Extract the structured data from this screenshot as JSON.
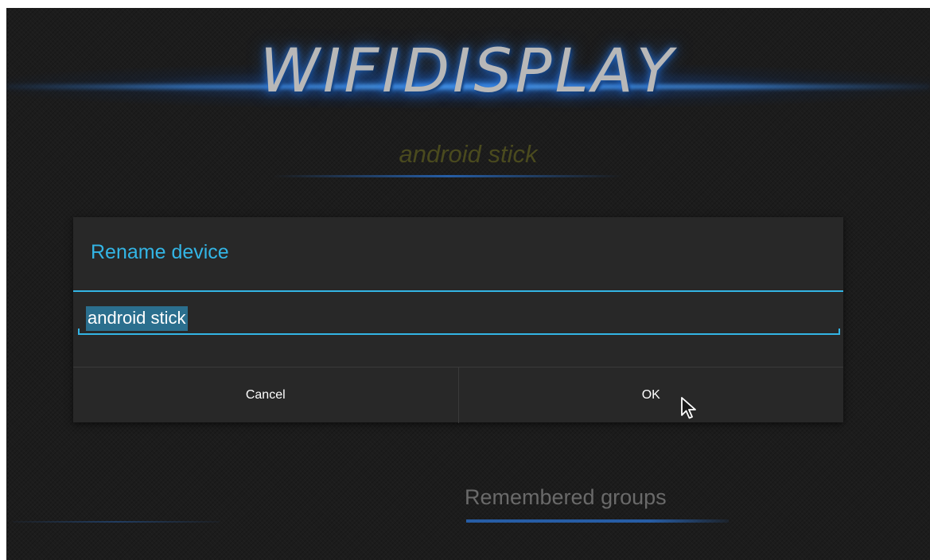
{
  "app": {
    "logo_text": "WIFIDISPLAY",
    "device_subtitle": "android stick"
  },
  "dialog": {
    "title": "Rename device",
    "input_value": "android stick",
    "cancel_label": "Cancel",
    "ok_label": "OK"
  },
  "background": {
    "section_label": "Remembered groups"
  },
  "icons": {
    "cursor": "mouse-pointer-icon"
  },
  "colors": {
    "accent": "#33b5e5",
    "dialog_bg": "#282828",
    "selection": "#2b6f8e"
  }
}
